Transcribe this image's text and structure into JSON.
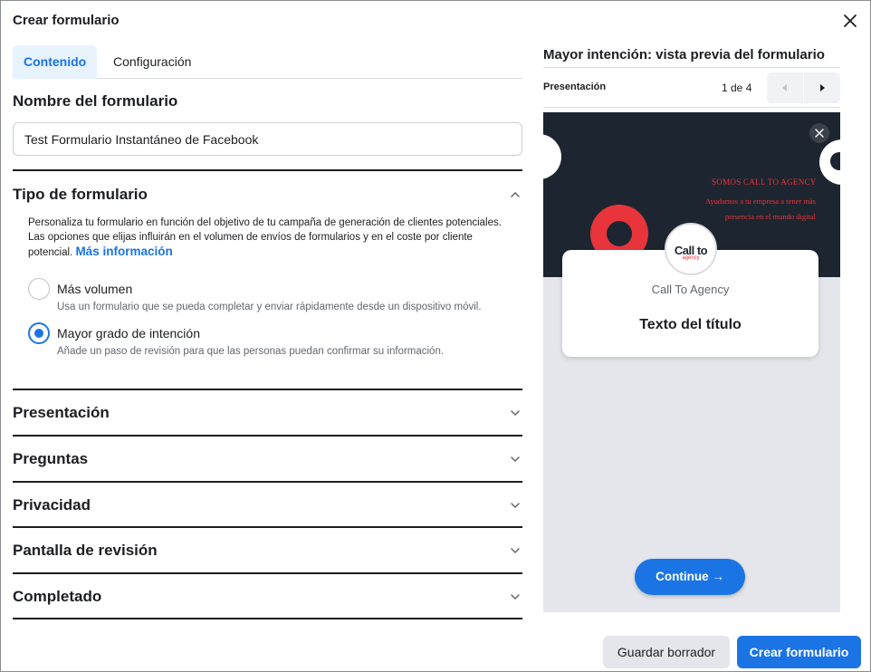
{
  "dialog": {
    "title": "Crear formulario"
  },
  "tabs": [
    {
      "label": "Contenido",
      "active": true
    },
    {
      "label": "Configuración",
      "active": false
    }
  ],
  "form_name": {
    "title": "Nombre del formulario",
    "value": "Test Formulario Instantáneo de Facebook"
  },
  "form_type": {
    "title": "Tipo de formulario",
    "description": "Personaliza tu formulario en función del objetivo de tu campaña de generación de clientes potenciales. Las opciones que elijas influirán en el volumen de envíos de formularios y en el coste por cliente potencial.",
    "link": "Más información",
    "options": [
      {
        "label": "Más volumen",
        "help": "Usa un formulario que se pueda completar y enviar rápidamente desde un dispositivo móvil.",
        "selected": false
      },
      {
        "label": "Mayor grado de intención",
        "help": "Añade un paso de revisión para que las personas puedan confirmar su información.",
        "selected": true
      }
    ]
  },
  "sections": [
    {
      "title": "Presentación"
    },
    {
      "title": "Preguntas"
    },
    {
      "title": "Privacidad"
    },
    {
      "title": "Pantalla de revisión"
    },
    {
      "title": "Completado"
    }
  ],
  "preview": {
    "title": "Mayor intención: vista previa del formulario",
    "step_label": "Presentación",
    "page_indicator": "1 de 4",
    "banner_line1": "SOMOS CALL TO AGENCY",
    "banner_line2": "Ayudamos a tu empresa a tener más presencia en el mundo digital",
    "logo_main": "Call to",
    "logo_sub": "agency",
    "company": "Call To Agency",
    "heading": "Texto del título",
    "continue_label": "Continue →"
  },
  "footer": {
    "save_draft": "Guardar borrador",
    "create": "Crear formulario"
  },
  "colors": {
    "accent": "#1b74e4",
    "banner_bg": "#1d2530",
    "brand_red": "#e8343b"
  }
}
